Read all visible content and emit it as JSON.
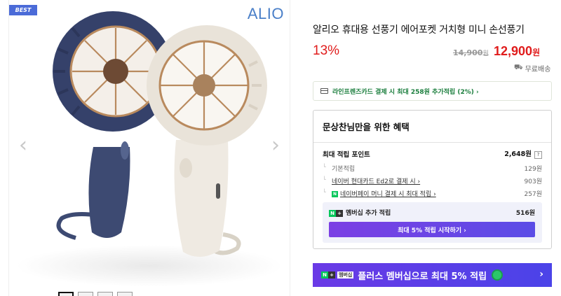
{
  "badge": "BEST",
  "brand_logo": "ALIO",
  "product": {
    "title": "알리오 휴대용 선풍기 에어포켓 거치형 미니 손선풍기",
    "discount": "13%",
    "original_price": "14,900",
    "original_unit": "원",
    "sale_price": "12,900",
    "sale_unit": "원",
    "shipping": "무료배송"
  },
  "card_banner": "라인프렌즈카드 결제 시 최대 258원 추가적립 (2%) ›",
  "benefits": {
    "heading": "문상찬님만을 위한 혜택",
    "max_points_label": "최대 적립 포인트",
    "max_points_value": "2,648원",
    "help": "?",
    "rows": [
      {
        "label": "기본적립",
        "value": "129원"
      },
      {
        "label": "네이버 현대카드 Ed2로 결제 시 ›",
        "value": "903원"
      },
      {
        "label": "네이버페이 머니 결제 시 최대 적립 ›",
        "value": "257원"
      }
    ],
    "membership_label": "멤버십 추가 적립",
    "membership_value": "516원",
    "membership_button": "최대 5% 적립 시작하기 ›"
  },
  "plus_banner": {
    "tag": "멤버십",
    "text": "플러스 멤버십으로 최대 5% 적립"
  },
  "colors": {
    "sale_red": "#e01c1c",
    "naver_green": "#03c75a",
    "membership_purple": "#6a3ae6",
    "brand_blue": "#4a7fc8"
  }
}
